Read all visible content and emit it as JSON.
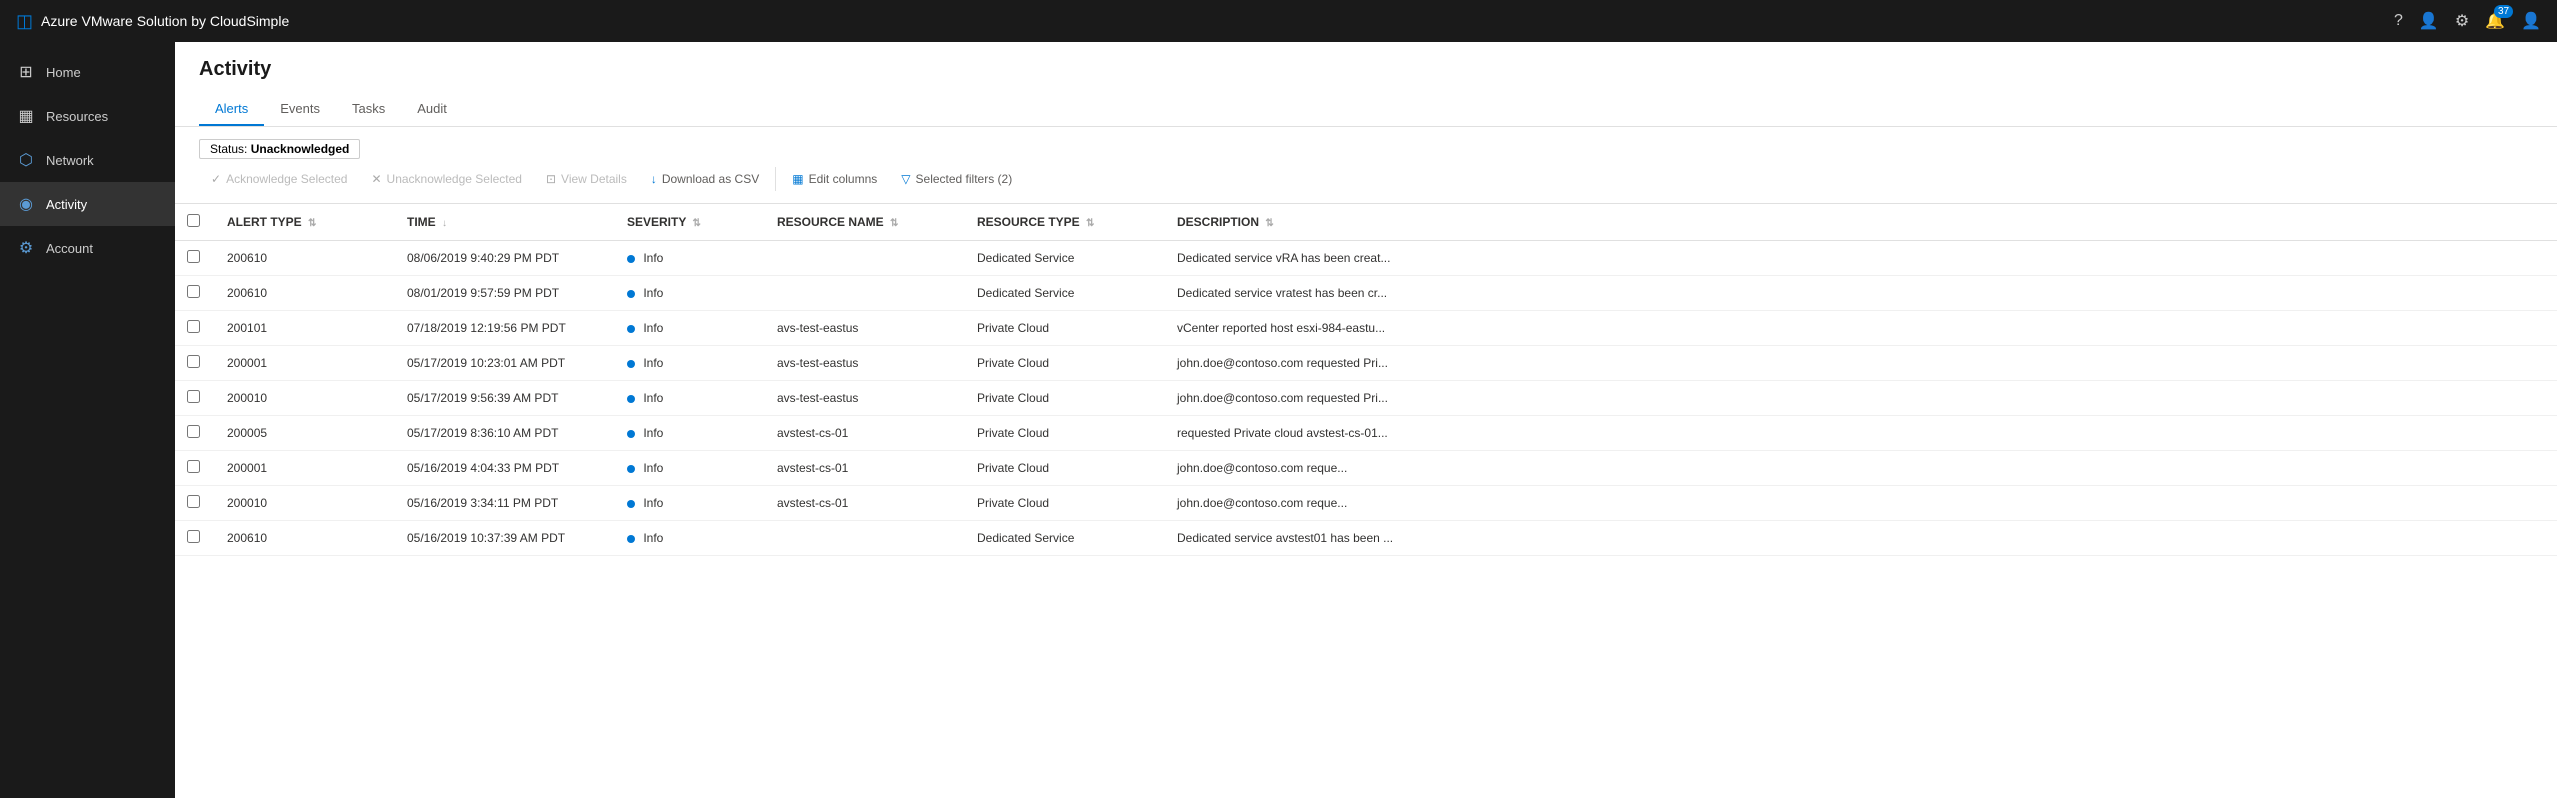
{
  "topbar": {
    "brand": "Azure VMware Solution by CloudSimple",
    "notification_count": "37"
  },
  "sidebar": {
    "items": [
      {
        "id": "home",
        "label": "Home",
        "icon": "⊞",
        "active": false
      },
      {
        "id": "resources",
        "label": "Resources",
        "icon": "▦",
        "active": false
      },
      {
        "id": "network",
        "label": "Network",
        "icon": "⬡",
        "active": false
      },
      {
        "id": "activity",
        "label": "Activity",
        "icon": "◉",
        "active": true
      },
      {
        "id": "account",
        "label": "Account",
        "icon": "⚙",
        "active": false
      }
    ]
  },
  "page": {
    "title": "Activity"
  },
  "tabs": [
    {
      "id": "alerts",
      "label": "Alerts",
      "active": true
    },
    {
      "id": "events",
      "label": "Events",
      "active": false
    },
    {
      "id": "tasks",
      "label": "Tasks",
      "active": false
    },
    {
      "id": "audit",
      "label": "Audit",
      "active": false
    }
  ],
  "filter_badge": {
    "prefix": "Status:",
    "value": "Unacknowledged"
  },
  "toolbar": {
    "actions": [
      {
        "id": "acknowledge",
        "label": "Acknowledge Selected",
        "icon": "✓",
        "disabled": true
      },
      {
        "id": "unacknowledge",
        "label": "Unacknowledge Selected",
        "icon": "✕",
        "disabled": true
      },
      {
        "id": "view-details",
        "label": "View Details",
        "icon": "⊡",
        "disabled": true
      },
      {
        "id": "download-csv",
        "label": "Download as CSV",
        "icon": "↓",
        "disabled": false
      },
      {
        "id": "edit-columns",
        "label": "Edit columns",
        "icon": "▦",
        "disabled": false
      },
      {
        "id": "selected-filters",
        "label": "Selected filters (2)",
        "icon": "▽",
        "disabled": false
      }
    ]
  },
  "table": {
    "columns": [
      {
        "id": "alert-type",
        "label": "ALERT TYPE",
        "sortable": true
      },
      {
        "id": "time",
        "label": "TIME",
        "sortable": true
      },
      {
        "id": "severity",
        "label": "SEVERITY",
        "sortable": true
      },
      {
        "id": "resource-name",
        "label": "RESOURCE NAME",
        "sortable": true
      },
      {
        "id": "resource-type",
        "label": "RESOURCE TYPE",
        "sortable": true
      },
      {
        "id": "description",
        "label": "DESCRIPTION",
        "sortable": true
      }
    ],
    "rows": [
      {
        "alert_type": "200610",
        "time": "08/06/2019 9:40:29 PM PDT",
        "severity": "Info",
        "severity_level": "info",
        "resource_name": "",
        "resource_type": "Dedicated Service",
        "description": "Dedicated service vRA has been creat..."
      },
      {
        "alert_type": "200610",
        "time": "08/01/2019 9:57:59 PM PDT",
        "severity": "Info",
        "severity_level": "info",
        "resource_name": "",
        "resource_type": "Dedicated Service",
        "description": "Dedicated service vratest has been cr..."
      },
      {
        "alert_type": "200101",
        "time": "07/18/2019 12:19:56 PM PDT",
        "severity": "Info",
        "severity_level": "info",
        "resource_name": "avs-test-eastus",
        "resource_type": "Private Cloud",
        "description": "vCenter reported host esxi-984-eastu..."
      },
      {
        "alert_type": "200001",
        "time": "05/17/2019 10:23:01 AM PDT",
        "severity": "Info",
        "severity_level": "info",
        "resource_name": "avs-test-eastus",
        "resource_type": "Private Cloud",
        "description": "john.doe@contoso.com requested Pri..."
      },
      {
        "alert_type": "200010",
        "time": "05/17/2019 9:56:39 AM PDT",
        "severity": "Info",
        "severity_level": "info",
        "resource_name": "avs-test-eastus",
        "resource_type": "Private Cloud",
        "description": "john.doe@contoso.com requested Pri..."
      },
      {
        "alert_type": "200005",
        "time": "05/17/2019 8:36:10 AM PDT",
        "severity": "Info",
        "severity_level": "info",
        "resource_name": "avstest-cs-01",
        "resource_type": "Private Cloud",
        "description": "requested Private cloud avstest-cs-01..."
      },
      {
        "alert_type": "200001",
        "time": "05/16/2019 4:04:33 PM PDT",
        "severity": "Info",
        "severity_level": "info",
        "resource_name": "avstest-cs-01",
        "resource_type": "Private Cloud",
        "description": "john.doe@contoso.com   reque..."
      },
      {
        "alert_type": "200010",
        "time": "05/16/2019 3:34:11 PM PDT",
        "severity": "Info",
        "severity_level": "info",
        "resource_name": "avstest-cs-01",
        "resource_type": "Private Cloud",
        "description": "john.doe@contoso.com   reque..."
      },
      {
        "alert_type": "200610",
        "time": "05/16/2019 10:37:39 AM PDT",
        "severity": "Info",
        "severity_level": "info",
        "resource_name": "",
        "resource_type": "Dedicated Service",
        "description": "Dedicated service avstest01 has been ..."
      }
    ]
  }
}
